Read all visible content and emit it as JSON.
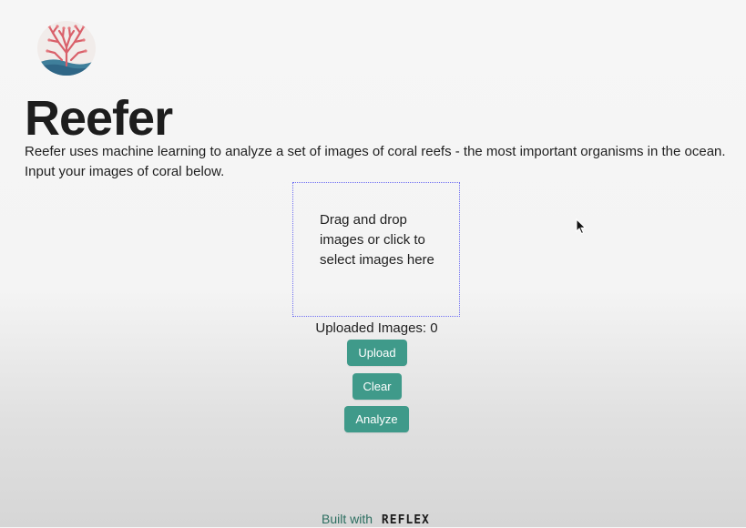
{
  "header": {
    "title": "Reefer",
    "logo_icon": "coral-logo-icon"
  },
  "description": {
    "line1": "Reefer uses machine learning to analyze a set of images of coral reefs - the most important organisms in the ocean.",
    "line2": "Input your images of coral below."
  },
  "dropzone": {
    "text": "Drag and drop images or click to select images here",
    "border_color": "#6f6ff2"
  },
  "status": {
    "uploaded_label": "Uploaded Images: 0"
  },
  "buttons": {
    "upload": "Upload",
    "clear": "Clear",
    "analyze": "Analyze",
    "color": "#3f9a8a"
  },
  "footer": {
    "built_with": "Built with",
    "brand": "REFLEX"
  },
  "cursor": {
    "icon": "mouse-pointer-icon"
  }
}
